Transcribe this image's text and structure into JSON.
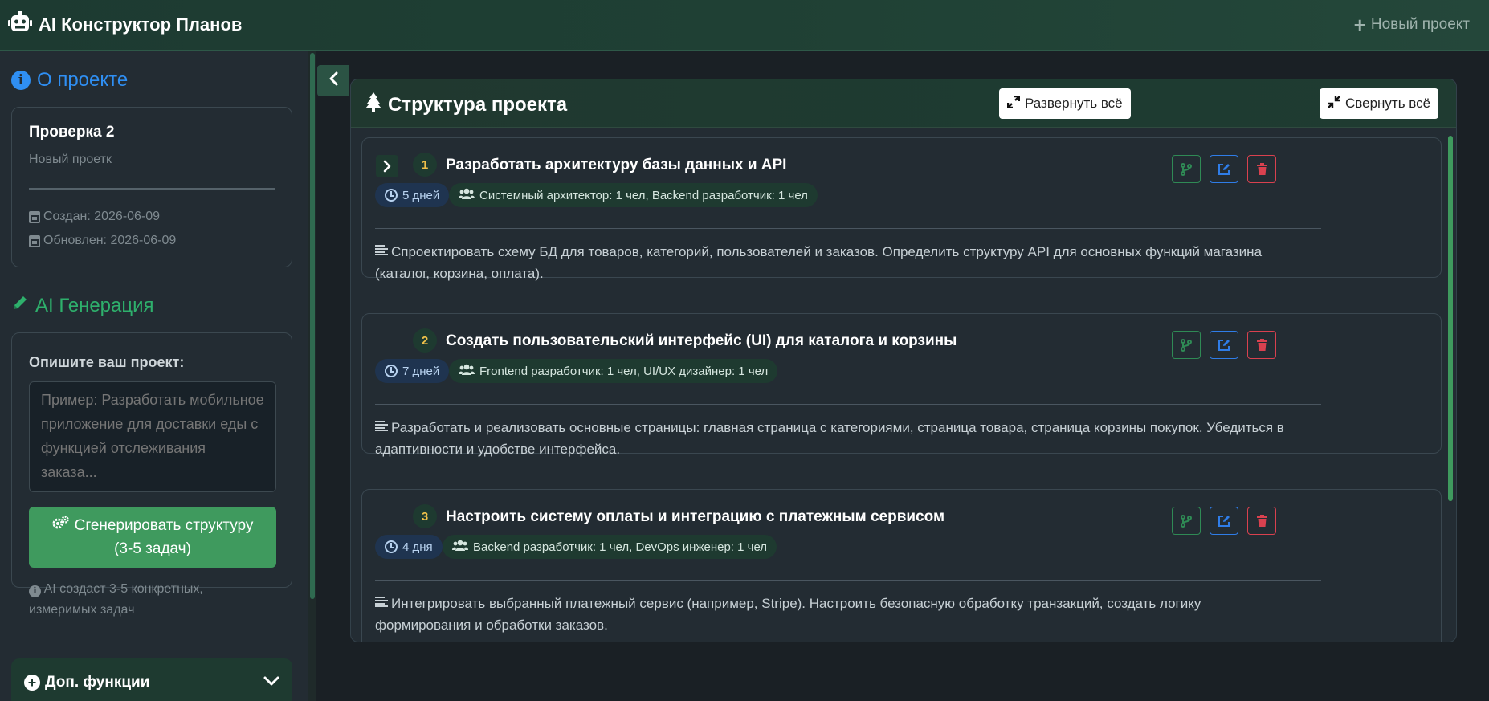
{
  "header": {
    "app_title": "AI Конструктор Планов",
    "new_project_label": "Новый проект"
  },
  "sidebar": {
    "about": {
      "title": "О проекте",
      "project_name": "Проверка 2",
      "project_desc": "Новый проетк",
      "created": "Создан: 2026-06-09",
      "updated": "Обновлен: 2026-06-09"
    },
    "ai": {
      "title": "AI Генерация",
      "describe_label": "Опишите ваш проект:",
      "textarea_placeholder": "Пример: Разработать мобильное приложение для доставки еды с функцией отслеживания заказа...",
      "generate_line1": "Сгенерировать структуру",
      "generate_line2": "(3-5 задач)",
      "hint": "AI создаст 3-5 конкретных, измеримых задач"
    },
    "extra": {
      "label": "Доп. функции"
    }
  },
  "panel": {
    "title": "Структура проекта",
    "expand_all": "Развернуть всё",
    "collapse_all": "Свернуть всё"
  },
  "tasks": [
    {
      "num": "1",
      "title": "Разработать архитектуру базы данных и API",
      "duration": "5 дней",
      "team": "Системный архитектор: 1 чел, Backend разработчик: 1 чел",
      "desc": "Спроектировать схему БД для товаров, категорий, пользователей и заказов. Определить структуру API для основных функций магазина (каталог, корзина, оплата)."
    },
    {
      "num": "2",
      "title": "Создать пользовательский интерфейс (UI) для каталога и корзины",
      "duration": "7 дней",
      "team": "Frontend разработчик: 1 чел, UI/UX дизайнер: 1 чел",
      "desc": "Разработать и реализовать основные страницы: главная страница с категориями, страница товара, страница корзины покупок. Убедиться в адаптивности и удобстве интерфейса."
    },
    {
      "num": "3",
      "title": "Настроить систему оплаты и интеграцию с платежным сервисом",
      "duration": "4 дня",
      "team": "Backend разработчик: 1 чел, DevOps инженер: 1 чел",
      "desc": "Интегрировать выбранный платежный сервис (например, Stripe). Настроить безопасную обработку транзакций, создать логику формирования и обработки заказов."
    }
  ],
  "colors": {
    "accent_green": "#3f9a5e",
    "accent_blue": "#2f8ff3",
    "danger": "#d9414f",
    "number_badge": "#f0c14a"
  }
}
